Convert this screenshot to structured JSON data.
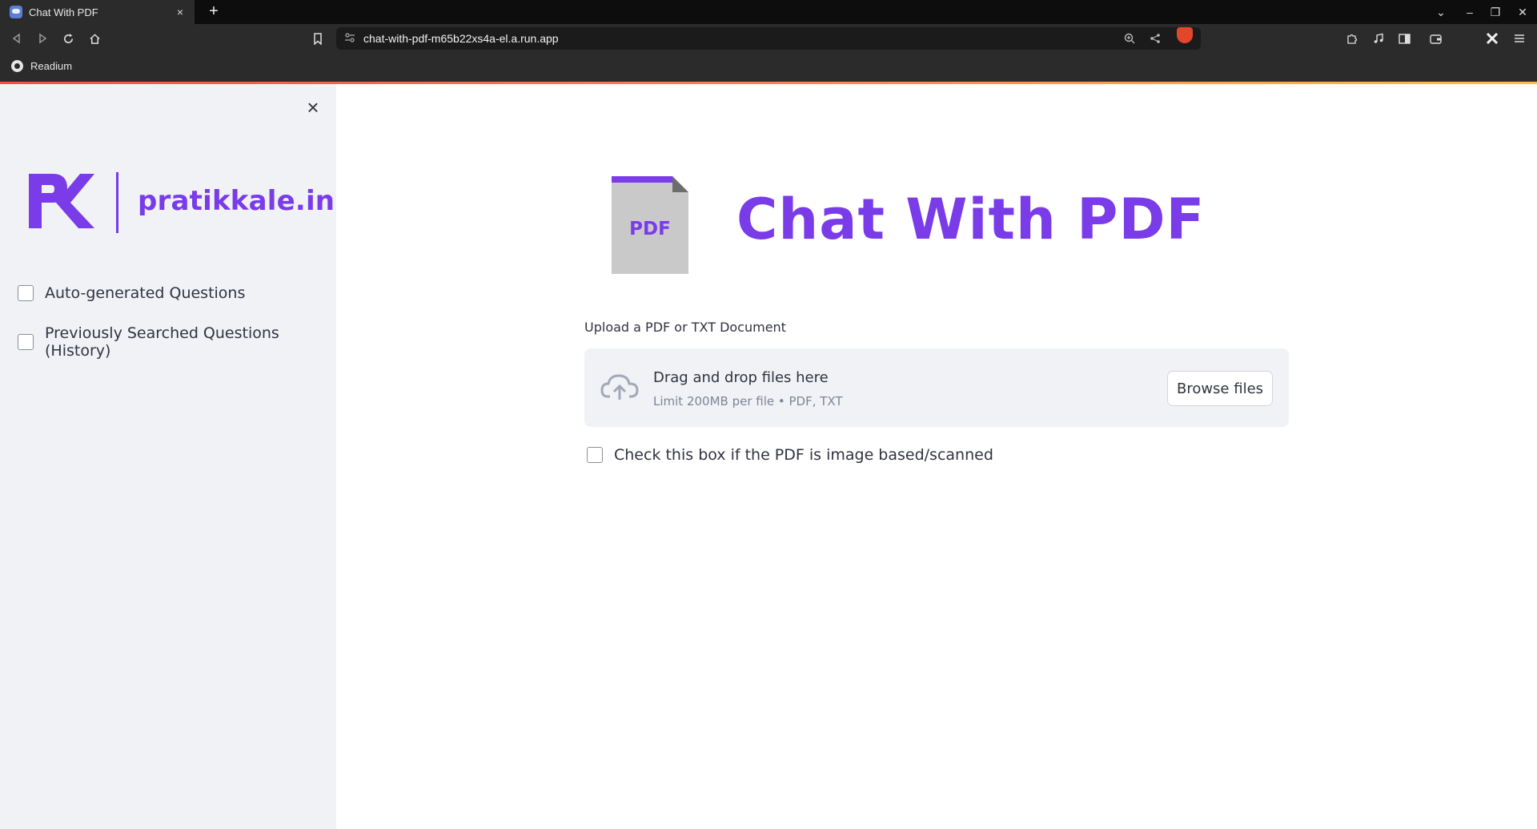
{
  "browser": {
    "tab_title": "Chat With PDF",
    "tab_close": "×",
    "new_tab": "+",
    "url": "chat-with-pdf-m65b22xs4a-el.a.run.app",
    "bookmark": "Readium",
    "controls": {
      "minimize": "–",
      "maximize": "❐",
      "close": "✕",
      "dropdown": "⌄"
    }
  },
  "sidebar": {
    "close_glyph": "×",
    "logo_text": "pratikkale.in",
    "checkboxes": [
      {
        "label": "Auto-generated Questions",
        "checked": false
      },
      {
        "label": "Previously Searched Questions (History)",
        "checked": false
      }
    ]
  },
  "main": {
    "pdf_icon_text": "PDF",
    "title": "Chat With PDF",
    "uploader": {
      "label": "Upload a PDF or TXT Document",
      "drop_title": "Drag and drop files here",
      "drop_subtitle": "Limit 200MB per file • PDF, TXT",
      "button": "Browse files"
    },
    "scan_checkbox": {
      "label": "Check this box if the PDF is image based/scanned",
      "checked": false
    }
  },
  "colors": {
    "brand": "#7a3be8",
    "sidebar_bg": "#f0f2f6",
    "text": "#31333f",
    "chrome_bg": "#2b2b2b"
  }
}
